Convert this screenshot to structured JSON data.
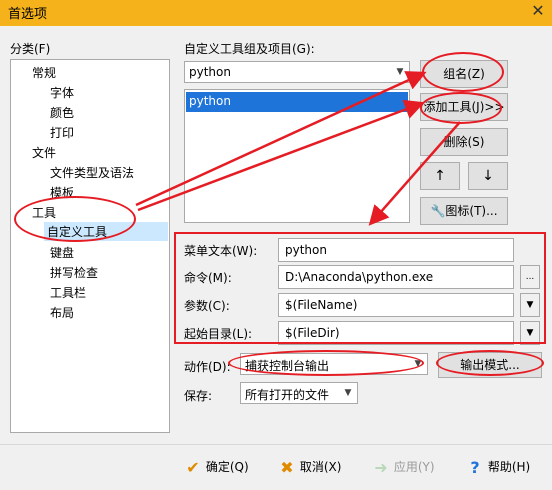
{
  "window": {
    "title": "首选项",
    "close": "✕"
  },
  "category": {
    "label": "分类(F)",
    "items": [
      {
        "label": "常规",
        "level": 0
      },
      {
        "label": "字体",
        "level": 1
      },
      {
        "label": "颜色",
        "level": 1
      },
      {
        "label": "打印",
        "level": 1
      },
      {
        "label": "文件",
        "level": 0
      },
      {
        "label": "文件类型及语法",
        "level": 1
      },
      {
        "label": "模板",
        "level": 1
      },
      {
        "label": "工具",
        "level": 0
      },
      {
        "label": "自定义工具",
        "level": 1,
        "selected": true
      },
      {
        "label": "键盘",
        "level": 1
      },
      {
        "label": "拼写检查",
        "level": 1
      },
      {
        "label": "工具栏",
        "level": 1
      },
      {
        "label": "布局",
        "level": 1
      }
    ]
  },
  "tools": {
    "group_label": "自定义工具组及项目(G):",
    "group_value": "python",
    "list_items": [
      "python"
    ],
    "buttons": {
      "group_name": "组名(Z)",
      "add_tool": "添加工具(J)>>",
      "delete": "删除(S)",
      "up": "↑",
      "down": "↓",
      "icon": "图标(T)..."
    }
  },
  "form": {
    "menu_text_label": "菜单文本(W):",
    "menu_text_value": "python",
    "command_label": "命令(M):",
    "command_value": "D:\\Anaconda\\python.exe",
    "browse": "...",
    "args_label": "参数(C):",
    "args_value": "$(FileName)",
    "start_dir_label": "起始目录(L):",
    "start_dir_value": "$(FileDir)",
    "action_label": "动作(D):",
    "action_value": "捕获控制台输出",
    "output_mode": "输出模式...",
    "save_label": "保存:",
    "save_value": "所有打开的文件"
  },
  "footer": {
    "ok": "确定(Q)",
    "cancel": "取消(X)",
    "apply": "应用(Y)",
    "help": "帮助(H)"
  },
  "colors": {
    "accent": "#1e74d9",
    "annotation": "#e51c23",
    "titlebar": "#f5b21a"
  }
}
